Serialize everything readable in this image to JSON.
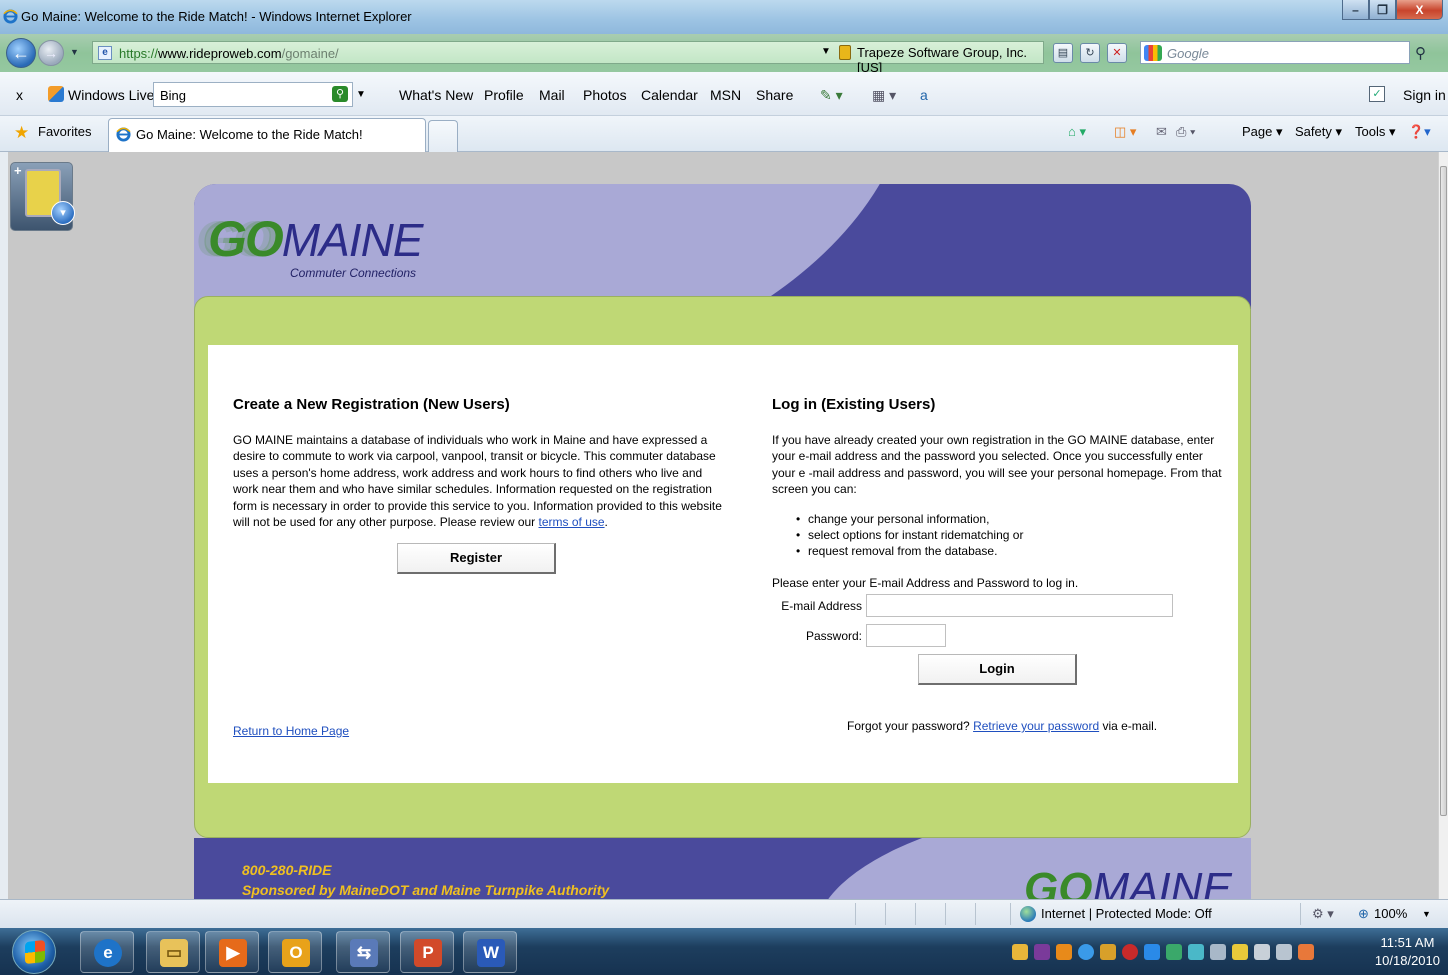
{
  "window": {
    "title": "Go Maine: Welcome to the Ride Match! - Windows Internet Explorer"
  },
  "address_bar": {
    "url_prefix": "https://",
    "url_domain": "www.rideproweb.com",
    "url_path": "/gomaine/",
    "certificate": "Trapeze Software Group, Inc. [US]",
    "search_placeholder": "Google"
  },
  "links_bar": {
    "close": "x",
    "windows_live": "Windows Live",
    "bing_value": "Bing",
    "items": [
      "What's New",
      "Profile",
      "Mail",
      "Photos",
      "Calendar",
      "MSN",
      "Share"
    ],
    "sign_in": "Sign in"
  },
  "favorites_bar": {
    "favorites": "Favorites",
    "tab_title": "Go Maine: Welcome to the Ride Match!",
    "commands": [
      "Page ▾",
      "Safety ▾",
      "Tools ▾"
    ]
  },
  "site": {
    "logo_go": "GO",
    "logo_maine": "MAINE",
    "logo_tagline": "Commuter Connections",
    "register": {
      "heading": "Create a New Registration (New Users)",
      "body": "GO MAINE maintains a database of individuals who work in Maine and have expressed a desire to commute to work via carpool, vanpool, transit or bicycle. This commuter database uses a person's home address, work address and work hours to find others who live and work near them and who have similar schedules. Information requested on the registration form is necessary in order to provide this service to you. Information provided to this website will not be used for any other purpose. Please review our ",
      "terms_link": "terms of use",
      "body_end": ".",
      "button": "Register",
      "home_link": "Return to Home Page"
    },
    "login": {
      "heading": "Log in (Existing Users)",
      "body": "If you have already created your own registration in the GO MAINE database, enter your e-mail address and the password you selected. Once you successfully enter your e -mail address and password, you will see your personal homepage. From that screen you can:",
      "bullets": [
        "change your personal information,",
        "select options for instant ridematching or",
        "request removal from the database."
      ],
      "prompt": "Please enter your E-mail Address and Password to log in.",
      "email_label": "E-mail Address",
      "email_value": "",
      "password_label": "Password:",
      "password_value": "",
      "button": "Login",
      "forgot_pre": "Forgot your password? ",
      "forgot_link": "Retrieve your password",
      "forgot_post": " via e-mail."
    },
    "footer": {
      "phone": "800-280-RIDE",
      "sponsor": "Sponsored by MaineDOT and Maine Turnpike Authority",
      "logo_go": "GO",
      "logo_maine": "MAINE"
    }
  },
  "status_bar": {
    "zone": "Internet | Protected Mode: Off",
    "zoom": "100%"
  },
  "taskbar": {
    "time": "11:51 AM",
    "date": "10/18/2010"
  },
  "colors": {
    "header_purple": "#4a4a9c",
    "header_lavender": "#a9a9d6",
    "content_green": "#bfd875",
    "logo_green": "#3a8a2a",
    "link_blue": "#1f4fbf",
    "footer_gold": "#f0c020"
  }
}
